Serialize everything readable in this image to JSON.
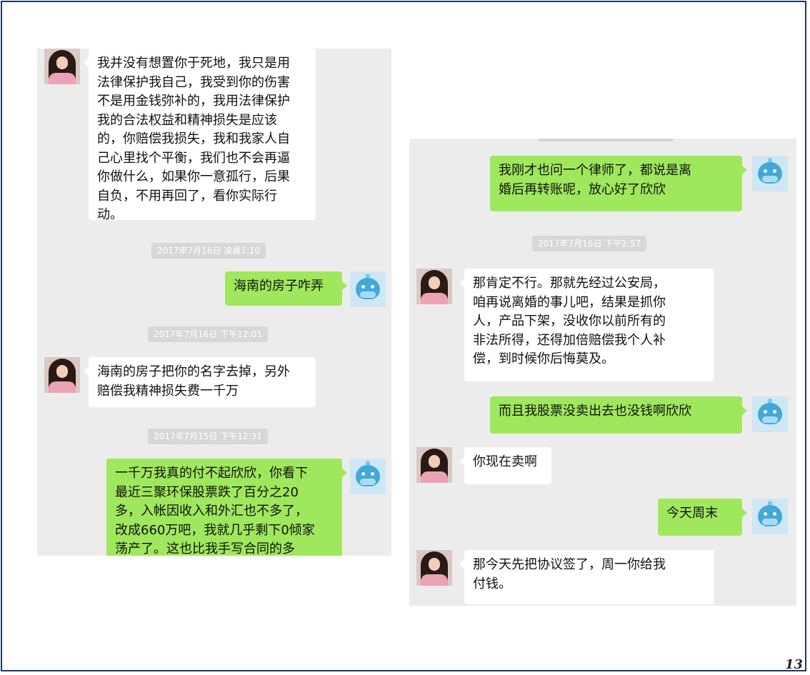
{
  "left_panel": {
    "messages": [
      {
        "text": "我并没有想置你于死地，我只是用\n法律保护我自己，我受到你的伤害\n不是用金钱弥补的，我用法律保护\n我的合法权益和精神损失是应该\n的，你赔偿我损失，我和我家人自\n己心里找个平衡，我们也不会再逼\n你做什么，如果你一意孤行，后果\n自负，不用再回了，看你实际行\n动。"
      },
      {
        "text": "海南的房子咋弄"
      },
      {
        "text": "海南的房子把你的名字去掉，另外\n赔偿我精神损失费一千万"
      },
      {
        "text": "一千万我真的付不起欣欣，你看下\n最近三聚环保股票跌了百分之20\n多，入帐因收入和外汇也不多了，\n改成660万吧，我就几乎剩下0倾家\n荡产了。这也比我手写合同的多"
      }
    ],
    "timestamps": [
      "2017年7月16日 凌晨1:10",
      "2017年7月16日 下午12:01",
      "2017年7月15日 下午12:31"
    ]
  },
  "right_panel": {
    "messages": [
      {
        "text": "我刚才也问一个律师了，都说是离\n婚后再转账呢，放心好了欣欣"
      },
      {
        "text": "那肯定不行。那就先经过公安局，\n咱再说离婚的事儿吧，结果是抓你\n人，产品下架，没收你以前所有的\n非法所得，还得加倍赔偿我个人补\n偿，到时候你后悔莫及。"
      },
      {
        "text": "而且我股票没卖出去也没钱啊欣欣"
      },
      {
        "text": "你现在卖啊"
      },
      {
        "text": "今天周末"
      },
      {
        "text": "那今天先把协议签了，周一你给我\n付钱。"
      }
    ],
    "timestamps": [
      "2017年7月16日 下午2:57"
    ]
  },
  "page_number": "13",
  "colors": {
    "outgoing_bubble": "#9fe75c",
    "incoming_bubble": "#ffffff",
    "panel_bg": "#ececec",
    "frame_border": "#1f3864"
  },
  "icons": {
    "incoming_avatar": "girl-avatar-icon",
    "outgoing_avatar": "whale-avatar-icon"
  }
}
